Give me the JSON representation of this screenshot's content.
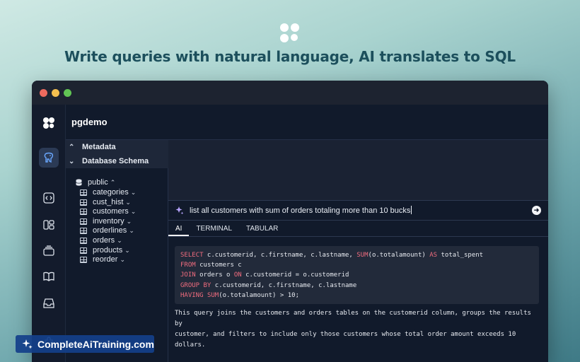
{
  "hero": {
    "headline": "Write queries with natural language, AI translates to SQL",
    "logo_icon": "four-dots-logo-icon"
  },
  "window": {
    "traffic_lights": {
      "close": "#ed6a5e",
      "minimize": "#f4bf4f",
      "maximize": "#61c554"
    }
  },
  "rail": {
    "items": [
      {
        "icon": "app-logo-icon"
      },
      {
        "icon": "postgres-elephant-icon",
        "active": true
      },
      {
        "icon": "code-brackets-icon"
      },
      {
        "icon": "layout-panels-icon"
      },
      {
        "icon": "stack-layers-icon"
      },
      {
        "icon": "open-book-icon"
      },
      {
        "icon": "inbox-tray-icon"
      },
      {
        "icon": "puzzle-plugin-icon"
      }
    ]
  },
  "header": {
    "database": "pgdemo"
  },
  "sidebar": {
    "metadata_label": "Metadata",
    "schema_label": "Database Schema",
    "schema_name": "public",
    "tables": [
      "categories",
      "cust_hist",
      "customers",
      "inventory",
      "orderlines",
      "orders",
      "products",
      "reorder"
    ]
  },
  "prompt": {
    "text": "list all customers with sum of orders totaling more than 10 bucks"
  },
  "tabs": [
    "AI",
    "TERMINAL",
    "TABULAR"
  ],
  "result": {
    "sql_lines": [
      [
        {
          "t": "SELECT",
          "k": 1
        },
        {
          "t": " c.customerid, c.firstname, c.lastname, "
        },
        {
          "t": "SUM",
          "k": 1
        },
        {
          "t": "(o.totalamount) "
        },
        {
          "t": "AS",
          "k": 1
        },
        {
          "t": " total_spent"
        }
      ],
      [
        {
          "t": "FROM",
          "k": 1
        },
        {
          "t": " customers c"
        }
      ],
      [
        {
          "t": "JOIN",
          "k": 1
        },
        {
          "t": " orders o "
        },
        {
          "t": "ON",
          "k": 1
        },
        {
          "t": " c.customerid = o.customerid"
        }
      ],
      [
        {
          "t": "GROUP BY",
          "k": 1
        },
        {
          "t": " c.customerid, c.firstname, c.lastname"
        }
      ],
      [
        {
          "t": "HAVING",
          "k": 1
        },
        {
          "t": " "
        },
        {
          "t": "SUM",
          "k": 1
        },
        {
          "t": "(o.totalamount) > 10;"
        }
      ]
    ],
    "explanation_line1": "This query joins the customers and orders tables on the customerid column, groups the results by",
    "explanation_line2": "customer, and filters to include only those customers whose total order amount exceeds 10 dollars."
  },
  "watermark": {
    "text": "CompleteAiTraining.com"
  }
}
